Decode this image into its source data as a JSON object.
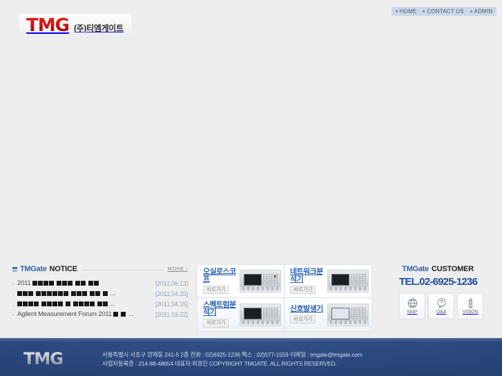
{
  "topnav": {
    "items": [
      {
        "label": "HOME",
        "name": "home"
      },
      {
        "label": "CONTACT US",
        "name": "contact-us"
      },
      {
        "label": "ADMIN",
        "name": "admin"
      }
    ]
  },
  "header": {
    "logo_mark": "TMG",
    "logo_sub": "(주)티엠게이트"
  },
  "notice": {
    "title_brand": "TMGate",
    "title_word": "NOTICE",
    "more_label": "MORE ›",
    "rows": [
      {
        "bullet": "-",
        "prefix": "2011",
        "boxes": [
          4,
          3,
          2,
          2
        ],
        "ellipsis": "",
        "date": "[2011.06.13]"
      },
      {
        "bullet": ".",
        "prefix": "",
        "boxes": [
          3,
          6,
          3,
          2,
          1
        ],
        "ellipsis": "...",
        "date": "[2011.04.25]"
      },
      {
        "bullet": ".",
        "prefix": "",
        "boxes": [
          4,
          4,
          1,
          4,
          2
        ],
        "ellipsis": "...",
        "date": "[2011.04.15]"
      },
      {
        "bullet": "-",
        "prefix": "Agilent Measurement Forum 2011",
        "boxes": [
          1,
          1
        ],
        "ellipsis": "...",
        "date": "[2011.03.22]"
      }
    ]
  },
  "products": {
    "go_label": "바로가기",
    "tiles": [
      {
        "name": "oscilloscope",
        "title": "오실로스코프",
        "screen": "dark"
      },
      {
        "name": "network-analyzer",
        "title": "네트워크분석기",
        "screen": "dark"
      },
      {
        "name": "spectrum-analyzer",
        "title": "스펙트럼분석기",
        "screen": "dark"
      },
      {
        "name": "signal-generator",
        "title": "신호발생기",
        "screen": "light"
      }
    ]
  },
  "customer": {
    "title_brand": "TMGate",
    "title_word": "CUSTOMER",
    "tel": "TEL.02-6925-1236",
    "buttons": [
      {
        "label": "MAP",
        "icon": "globe-icon"
      },
      {
        "label": "Q&A",
        "icon": "question-bubble-icon"
      },
      {
        "label": "VISION",
        "icon": "vision-tower-icon"
      }
    ]
  },
  "footer": {
    "logo_mark": "TMG",
    "line1": "서울특별시 서초구 양재동 241-5 2층   전화 : 02)6925-1236   팩스 : 02)577-1559   이메일 : tmgate@tmgate.com",
    "line2": "사업자등록증 : 214-88-48654   대표자:최경진   COPYRIGHT TMGATE. ALL RIGHTS RESERVED."
  },
  "colors": {
    "page_bg": "#eeeeee",
    "brand_red": "#d4110d",
    "brand_blue": "#2a63b0",
    "tel_blue": "#1d4f9c",
    "footer_blue": "#2a477c",
    "topnav_bg": "#ccd8e8"
  }
}
